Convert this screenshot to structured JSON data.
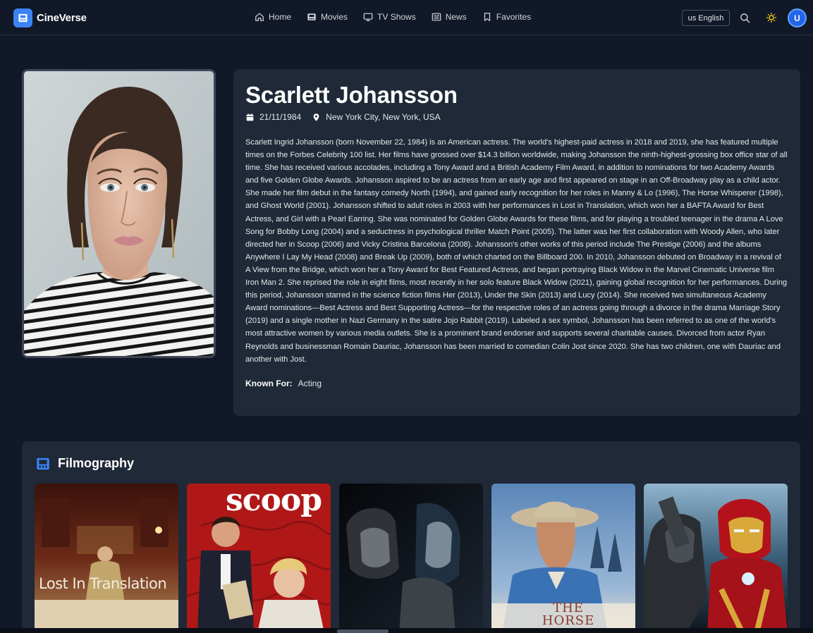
{
  "app": {
    "name": "CineVerse",
    "logo_icon": "film-icon",
    "accent": "#3b82f6"
  },
  "nav": {
    "items": [
      {
        "label": "Home",
        "icon": "home-icon"
      },
      {
        "label": "Movies",
        "icon": "film-icon"
      },
      {
        "label": "TV Shows",
        "icon": "tv-icon"
      },
      {
        "label": "News",
        "icon": "newspaper-icon"
      },
      {
        "label": "Favorites",
        "icon": "bookmark-icon"
      }
    ],
    "language": "us English",
    "avatar_initial": "U"
  },
  "person": {
    "name": "Scarlett Johansson",
    "birthday": "21/11/1984",
    "birthplace": "New York City, New York, USA",
    "biography": "Scarlett Ingrid Johansson (born November 22, 1984) is an American actress. The world's highest-paid actress in 2018 and 2019, she has featured multiple times on the Forbes Celebrity 100 list. Her films have grossed over $14.3 billion worldwide, making Johansson the ninth-highest-grossing box office star of all time. She has received various accolades, including a Tony Award and a British Academy Film Award, in addition to nominations for two Academy Awards and five Golden Globe Awards. Johansson aspired to be an actress from an early age and first appeared on stage in an Off-Broadway play as a child actor. She made her film debut in the fantasy comedy North (1994), and gained early recognition for her roles in Manny & Lo (1996), The Horse Whisperer (1998), and Ghost World (2001). Johansson shifted to adult roles in 2003 with her performances in Lost in Translation, which won her a BAFTA Award for Best Actress, and Girl with a Pearl Earring. She was nominated for Golden Globe Awards for these films, and for playing a troubled teenager in the drama A Love Song for Bobby Long (2004) and a seductress in psychological thriller Match Point (2005). The latter was her first collaboration with Woody Allen, who later directed her in Scoop (2006) and Vicky Cristina Barcelona (2008). Johansson's other works of this period include The Prestige (2006) and the albums Anywhere I Lay My Head (2008) and Break Up (2009), both of which charted on the Billboard 200. In 2010, Johansson debuted on Broadway in a revival of A View from the Bridge, which won her a Tony Award for Best Featured Actress, and began portraying Black Widow in the Marvel Cinematic Universe film Iron Man 2. She reprised the role in eight films, most recently in her solo feature Black Widow (2021), gaining global recognition for her performances. During this period, Johansson starred in the science fiction films Her (2013), Under the Skin (2013) and Lucy (2014). She received two simultaneous Academy Award nominations—Best Actress and Best Supporting Actress—for the respective roles of an actress going through a divorce in the drama Marriage Story (2019) and a single mother in Nazi Germany in the satire Jojo Rabbit (2019). Labeled a sex symbol, Johansson has been referred to as one of the world's most attractive women by various media outlets. She is a prominent brand endorser and supports several charitable causes. Divorced from actor Ryan Reynolds and businessman Romain Dauriac, Johansson has been married to comedian Colin Jost since 2020. She has two children, one with Dauriac and another with Jost.",
    "known_for_label": "Known For:",
    "known_for": "Acting"
  },
  "filmography": {
    "title": "Filmography",
    "icon": "film-icon",
    "posters": [
      {
        "text": "Lost In Translation"
      },
      {
        "text": "scoop"
      },
      {
        "text": ""
      },
      {
        "text": "THE HORSE"
      },
      {
        "text": ""
      }
    ]
  }
}
